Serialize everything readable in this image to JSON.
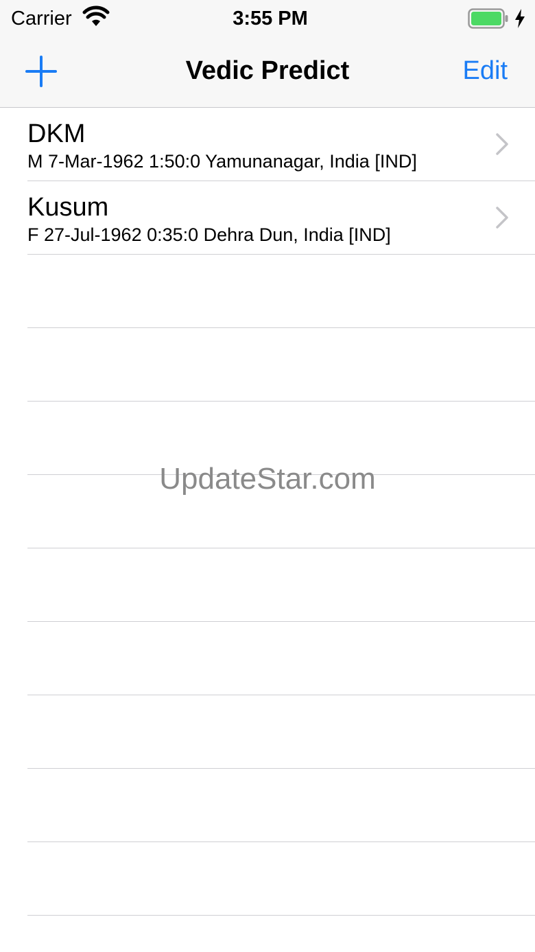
{
  "status_bar": {
    "carrier": "Carrier",
    "time": "3:55 PM",
    "icons": [
      "wifi-icon",
      "battery-icon",
      "charging-bolt-icon"
    ],
    "battery_color": "#4cd964"
  },
  "nav": {
    "title": "Vedic Predict",
    "add_icon": "plus-icon",
    "edit_label": "Edit",
    "accent_color": "#1a7cf5"
  },
  "list": {
    "items": [
      {
        "name": "DKM",
        "details": "M 7-Mar-1962 1:50:0 Yamunanagar, India [IND]"
      },
      {
        "name": "Kusum",
        "details": "F 27-Jul-1962 0:35:0 Dehra Dun, India [IND]"
      }
    ]
  },
  "watermark": "UpdateStar.com"
}
